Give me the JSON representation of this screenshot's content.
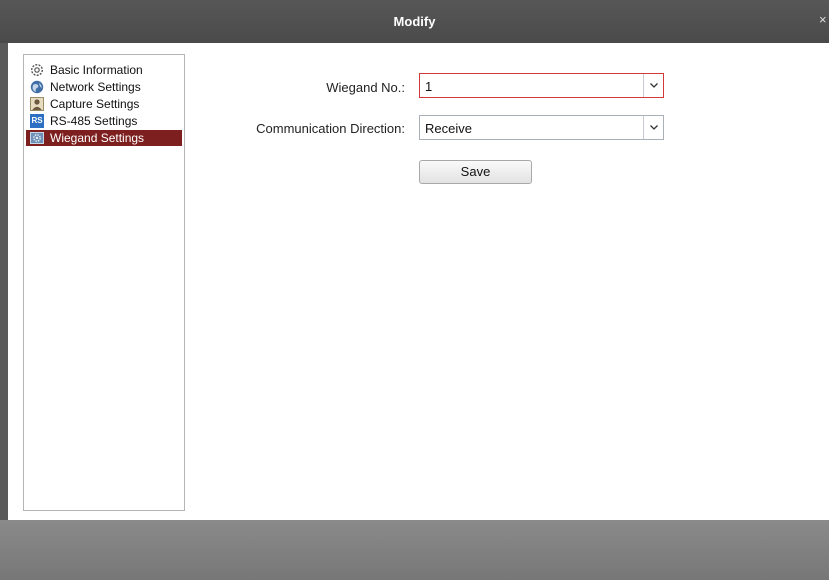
{
  "window": {
    "title": "Modify",
    "close_glyph": "×"
  },
  "nav": {
    "items": [
      {
        "label": "Basic Information",
        "icon": "gear-icon"
      },
      {
        "label": "Network Settings",
        "icon": "globe-icon"
      },
      {
        "label": "Capture Settings",
        "icon": "capture-icon"
      },
      {
        "label": "RS-485 Settings",
        "icon": "rs485-icon",
        "icon_text": "RS"
      },
      {
        "label": "Wiegand Settings",
        "icon": "wiegand-icon",
        "selected": true
      }
    ]
  },
  "form": {
    "wiegand_no": {
      "label": "Wiegand No.:",
      "value": "1"
    },
    "communication_direction": {
      "label": "Communication Direction:",
      "value": "Receive"
    },
    "save_label": "Save"
  },
  "colors": {
    "selected_nav": "#7d1f1f",
    "focus_border": "#d23a3a",
    "titlebar": "#4f4f4f",
    "footer": "#808080"
  }
}
